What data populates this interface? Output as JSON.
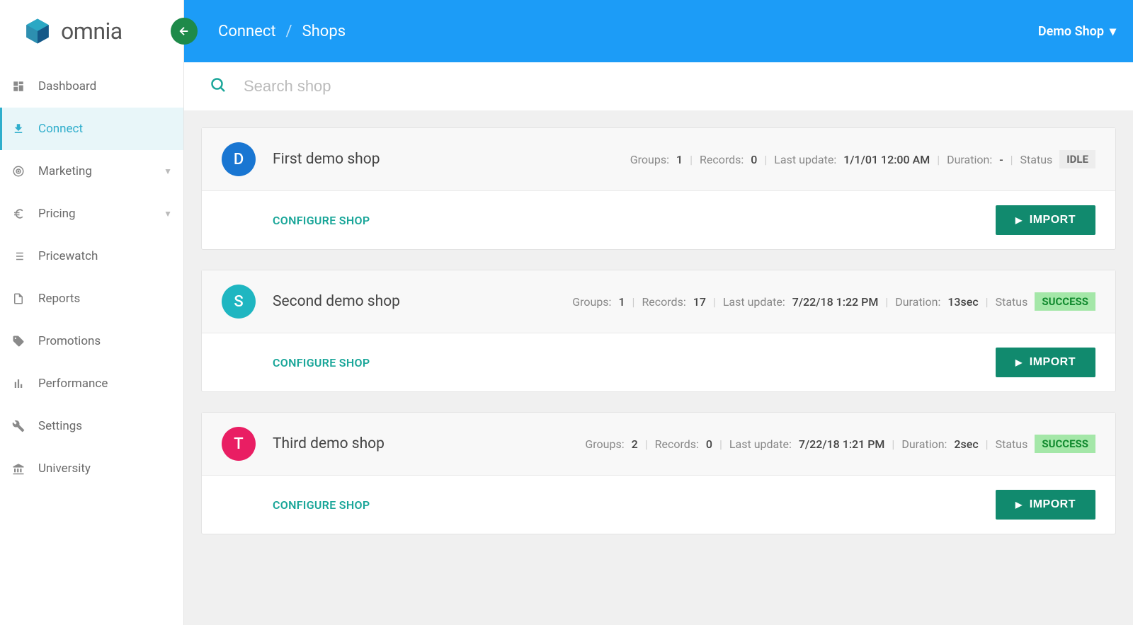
{
  "brand": "omnia",
  "sidebar": {
    "items": [
      {
        "label": "Dashboard",
        "icon": "dashboard",
        "active": false,
        "chevron": false
      },
      {
        "label": "Connect",
        "icon": "download",
        "active": true,
        "chevron": false
      },
      {
        "label": "Marketing",
        "icon": "target",
        "active": false,
        "chevron": true
      },
      {
        "label": "Pricing",
        "icon": "euro",
        "active": false,
        "chevron": true
      },
      {
        "label": "Pricewatch",
        "icon": "list",
        "active": false,
        "chevron": false
      },
      {
        "label": "Reports",
        "icon": "file",
        "active": false,
        "chevron": false
      },
      {
        "label": "Promotions",
        "icon": "tag",
        "active": false,
        "chevron": false
      },
      {
        "label": "Performance",
        "icon": "chart",
        "active": false,
        "chevron": false
      },
      {
        "label": "Settings",
        "icon": "wrench",
        "active": false,
        "chevron": false
      },
      {
        "label": "University",
        "icon": "university",
        "active": false,
        "chevron": false
      }
    ]
  },
  "header": {
    "breadcrumb": {
      "part1": "Connect",
      "part2": "Shops",
      "sep": "/"
    },
    "shop_selector": "Demo Shop"
  },
  "search": {
    "placeholder": "Search shop"
  },
  "labels": {
    "groups": "Groups:",
    "records": "Records:",
    "last_update": "Last update:",
    "duration": "Duration:",
    "status": "Status",
    "configure": "CONFIGURE SHOP",
    "import": "IMPORT"
  },
  "shops": [
    {
      "name": "First demo shop",
      "avatar_letter": "D",
      "avatar_color": "#1976d2",
      "groups": "1",
      "records": "0",
      "last_update": "1/1/01 12:00 AM",
      "duration": "-",
      "status": "IDLE",
      "status_class": "status-idle"
    },
    {
      "name": "Second demo shop",
      "avatar_letter": "S",
      "avatar_color": "#1fb6c1",
      "groups": "1",
      "records": "17",
      "last_update": "7/22/18 1:22 PM",
      "duration": "13sec",
      "status": "SUCCESS",
      "status_class": "status-success"
    },
    {
      "name": "Third demo shop",
      "avatar_letter": "T",
      "avatar_color": "#e91e63",
      "groups": "2",
      "records": "0",
      "last_update": "7/22/18 1:21 PM",
      "duration": "2sec",
      "status": "SUCCESS",
      "status_class": "status-success"
    }
  ]
}
